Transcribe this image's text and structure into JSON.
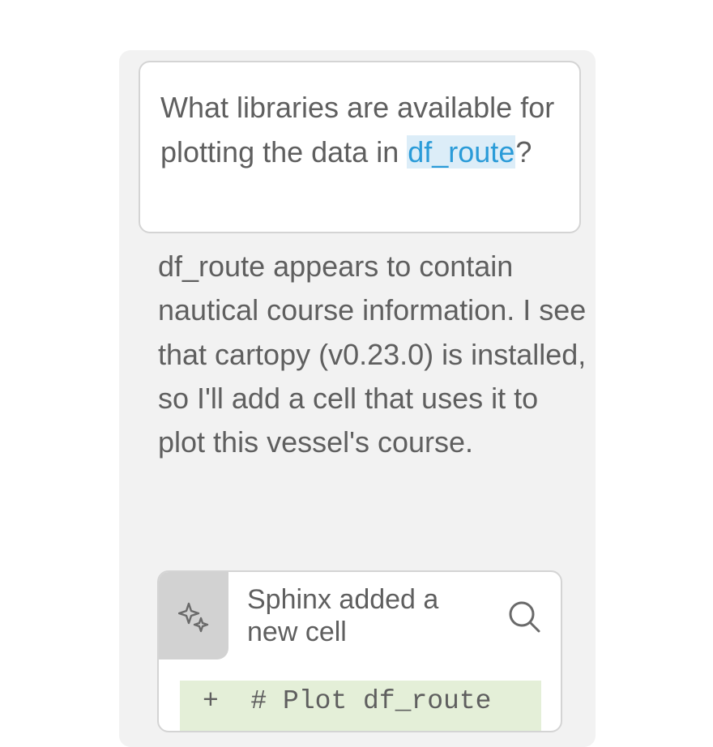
{
  "conversation": {
    "user_message": {
      "text_before": "What libraries are available for plotting the data in ",
      "mention": "df_route",
      "text_after": "?"
    },
    "assistant_message": {
      "text": "df_route appears to contain nautical course information. I see that cartopy (v0.23.0) is installed, so I'll add a cell that uses it to plot this vessel's course."
    },
    "cell_card": {
      "icon": "sparkle-icon",
      "title": "Sphinx added a new cell",
      "search_icon": "search-icon",
      "code_diff": {
        "marker": "+",
        "line": "# Plot df_route"
      }
    }
  },
  "colors": {
    "panel_bg": "#f2f2f2",
    "text": "#5f5f5f",
    "mention_text": "#2a9bd8",
    "mention_bg": "#dcedf8",
    "diff_added_bg": "#e4efd8"
  }
}
